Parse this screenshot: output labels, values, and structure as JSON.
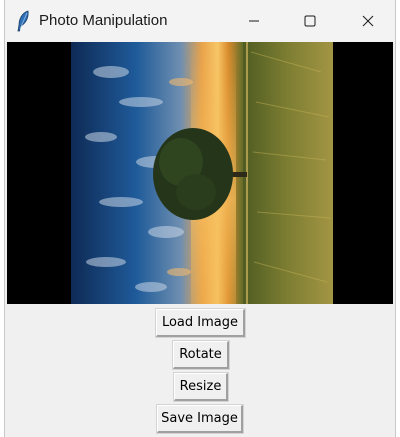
{
  "window": {
    "title": "Photo Manipulation",
    "icon": "feather-icon",
    "controls": {
      "minimize": "minimize-icon",
      "maximize": "maximize-icon",
      "close": "close-icon"
    }
  },
  "image": {
    "description_icon": "photo-image",
    "rotation_degrees": 90
  },
  "buttons": {
    "load_label": "Load Image",
    "rotate_label": "Rotate",
    "resize_label": "Resize",
    "save_label": "Save Image"
  },
  "colors": {
    "window_bg": "#f0f0f0",
    "canvas_bg": "#000000"
  }
}
